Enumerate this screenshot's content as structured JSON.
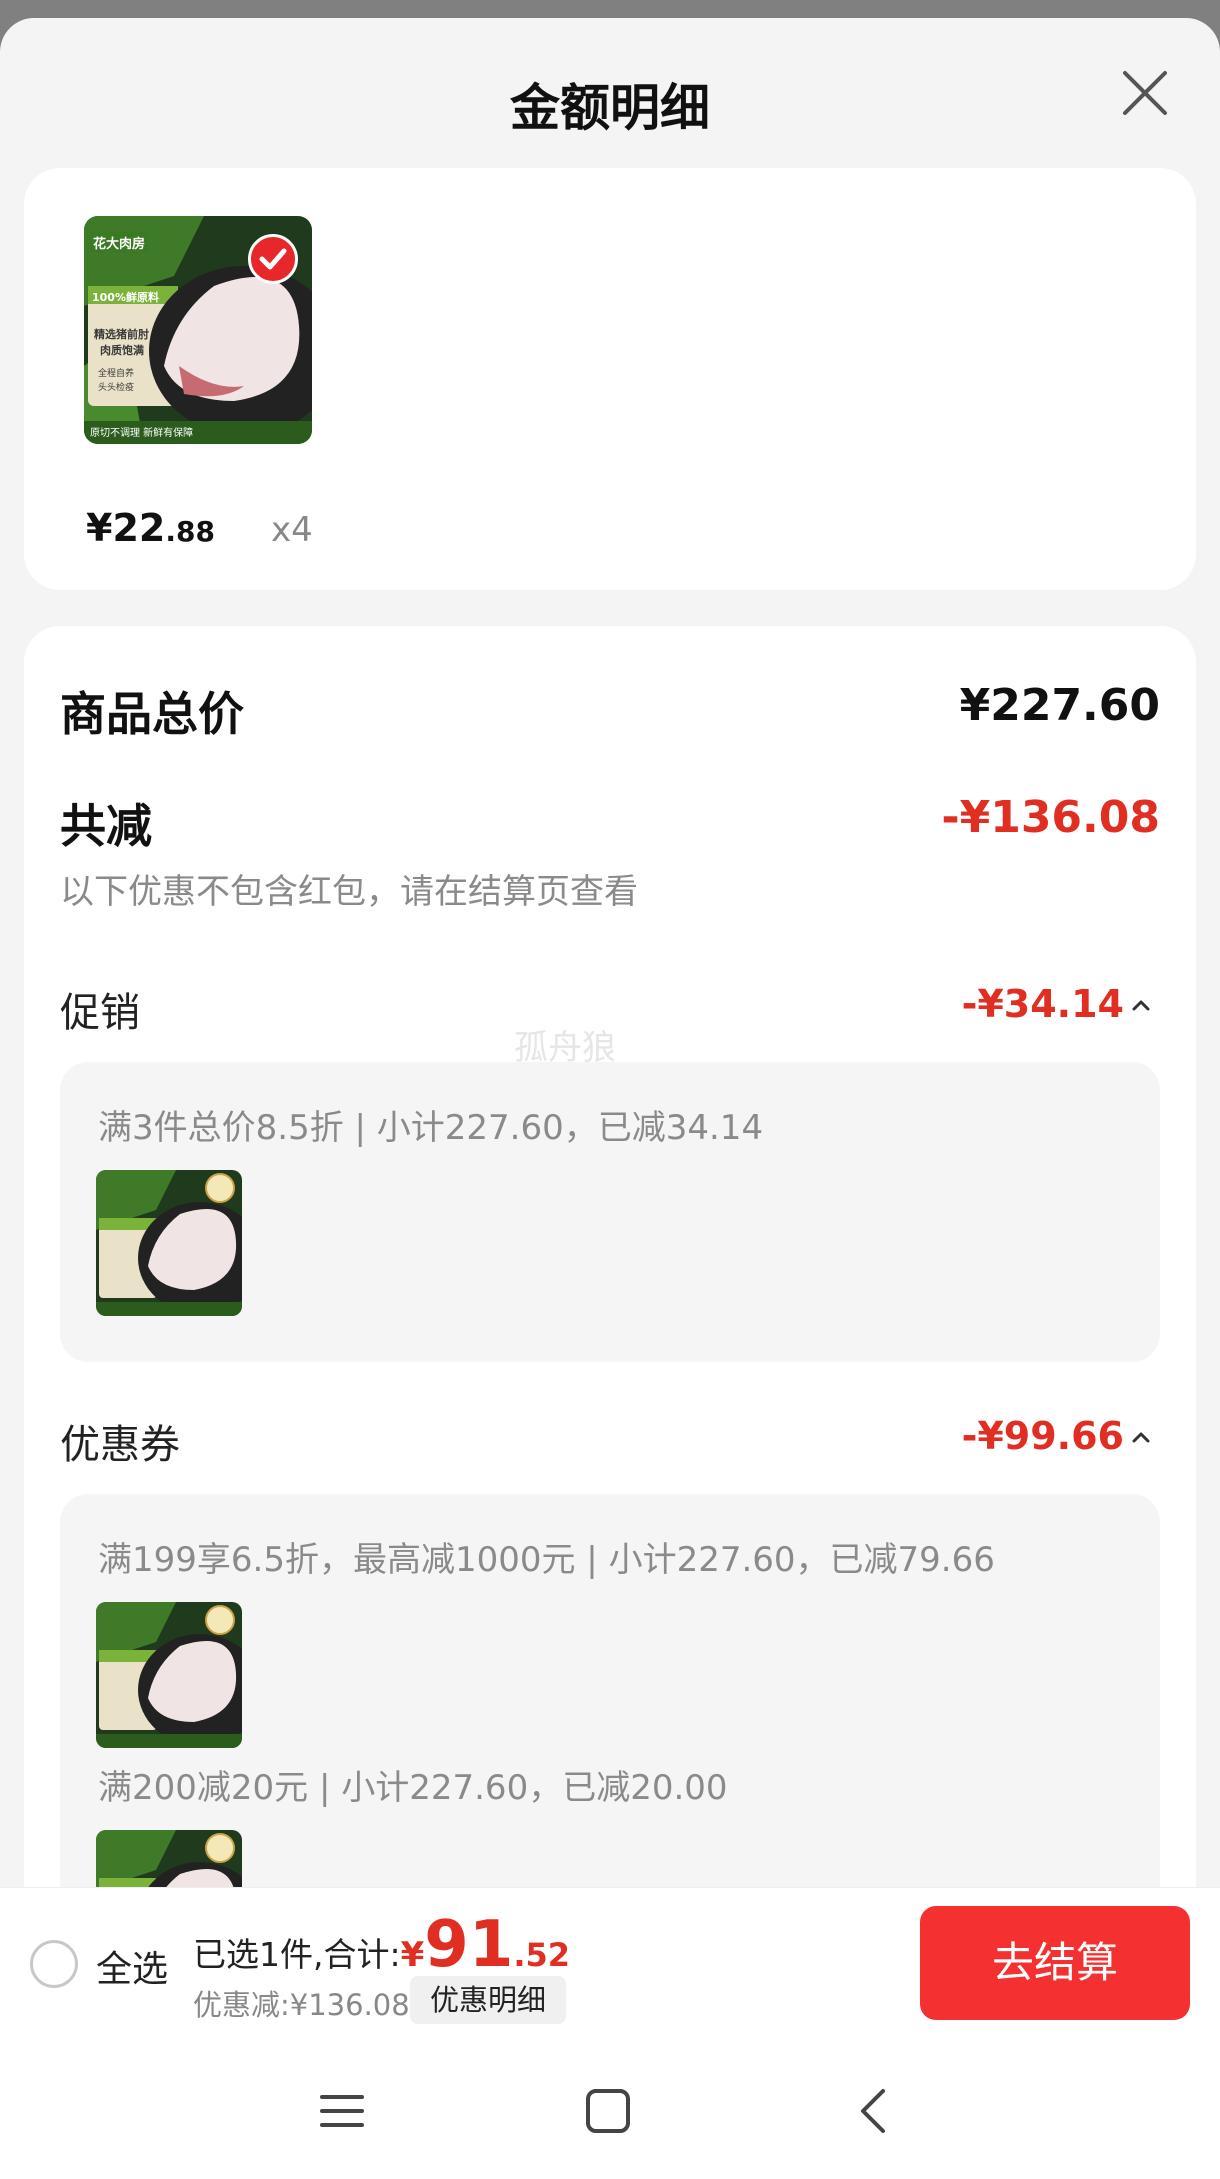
{
  "header": {
    "title": "金额明细"
  },
  "product": {
    "brand_logo_text": "花大肉房",
    "package_text": [
      "100%鲜原料",
      "精选猪前肘",
      "肉质饱满",
      "全程自养",
      "头头检疫",
      "原切不调理 新鲜有保障"
    ],
    "price_currency": "¥",
    "price_main": "22",
    "price_decimal": ".88",
    "quantity": "x4"
  },
  "summary_card": {
    "total_label": "商品总价",
    "total_value": "¥227.60",
    "reduce_label": "共减",
    "reduce_value": "-¥136.08",
    "note": "以下优惠不包含红包，请在结算页查看",
    "promo_label": "促销",
    "promo_value": "-¥34.14",
    "promo_items": [
      {
        "text": "满3件总价8.5折 | 小计227.60，已减34.14"
      }
    ],
    "coupon_label": "优惠券",
    "coupon_value": "-¥99.66",
    "coupon_items": [
      {
        "text": "满199享6.5折，最高减1000元 | 小计227.60，已减79.66"
      },
      {
        "text": "满200减20元 | 小计227.60，已减20.00"
      }
    ],
    "watermark": "孤舟狼"
  },
  "bottom_bar": {
    "select_all_label": "全选",
    "selected_label": "已选1件,合计:",
    "total_currency": "¥",
    "total_main": "91",
    "total_decimal": ".52",
    "discount_label": "优惠减:¥136.08",
    "detail_button": "优惠明细",
    "checkout_button": "去结算"
  },
  "colors": {
    "accent_red": "#e02f22",
    "checkout_button": "#f53030",
    "background": "#f4f4f4"
  },
  "icons": [
    "close-icon",
    "check-badge-icon",
    "chevron-up-icon",
    "menu-nav-icon",
    "home-nav-icon",
    "back-nav-icon"
  ]
}
